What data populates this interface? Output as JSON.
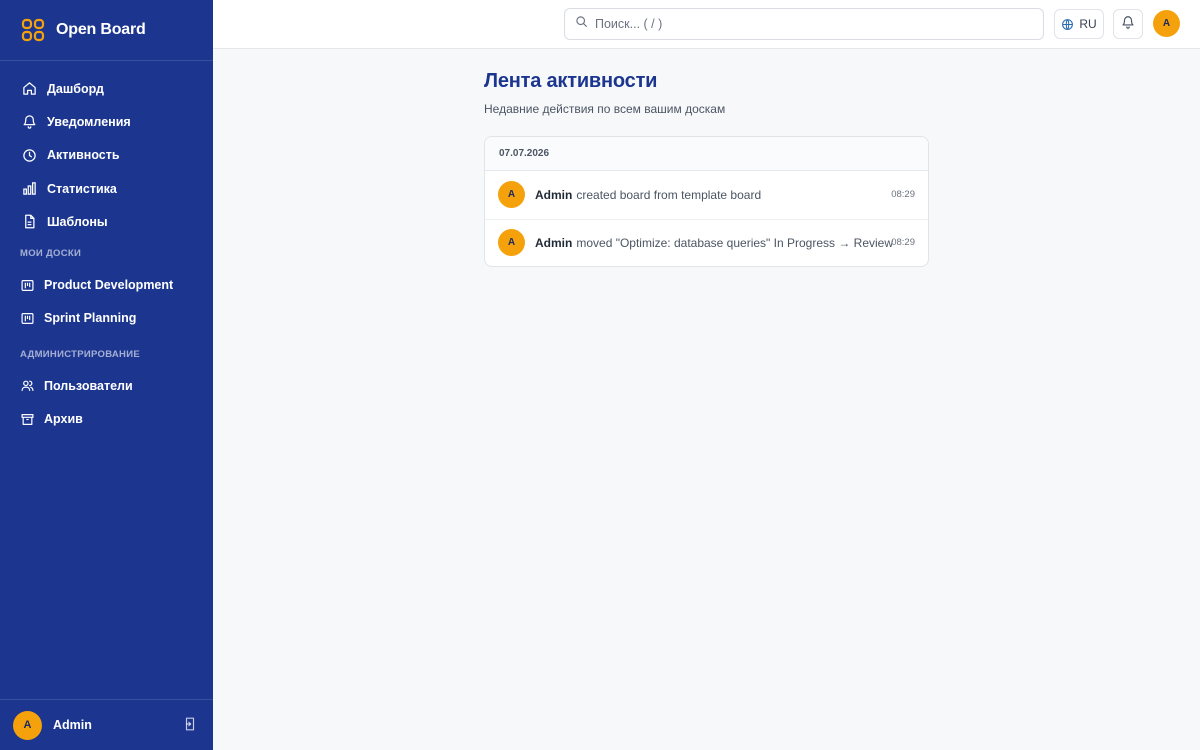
{
  "brand": {
    "name": "Open Board",
    "logo_color": "#f5a10b"
  },
  "sidebar": {
    "main_items": [
      {
        "label": "Дашборд",
        "icon": "home-icon"
      },
      {
        "label": "Уведомления",
        "icon": "bell-icon"
      },
      {
        "label": "Активность",
        "icon": "clock-icon"
      },
      {
        "label": "Статистика",
        "icon": "bar-chart-icon"
      },
      {
        "label": "Шаблоны",
        "icon": "document-icon"
      }
    ],
    "boards_section": "МОИ ДОСКИ",
    "boards": [
      {
        "label": "Product Development",
        "icon": "board-icon"
      },
      {
        "label": "Sprint Planning",
        "icon": "board-icon"
      }
    ],
    "admin_section": "АДМИНИСТРИРОВАНИЕ",
    "admin_items": [
      {
        "label": "Пользователи",
        "icon": "users-icon"
      },
      {
        "label": "Архив",
        "icon": "archive-icon"
      }
    ],
    "footer": {
      "avatar_initial": "A",
      "user_name": "Admin",
      "action_icon": "logout-icon"
    },
    "background": "#1c3690"
  },
  "topbar": {
    "search_placeholder": "Поиск... ( / )",
    "language": "RU",
    "avatar_initial": "A"
  },
  "main": {
    "title": "Лента активности",
    "subtitle": "Недавние действия по всем вашим доскам",
    "groups": [
      {
        "date": "07.07.2026",
        "entries": [
          {
            "avatar": "A",
            "actor": "Admin",
            "text": "created board from template board",
            "time": "08:29"
          },
          {
            "avatar": "A",
            "actor": "Admin",
            "text": "moved \"Optimize: database queries\" In Progress → Review",
            "time": "08:29"
          }
        ]
      }
    ]
  },
  "colors": {
    "accent": "#f5a10b",
    "title": "#1c3690"
  }
}
